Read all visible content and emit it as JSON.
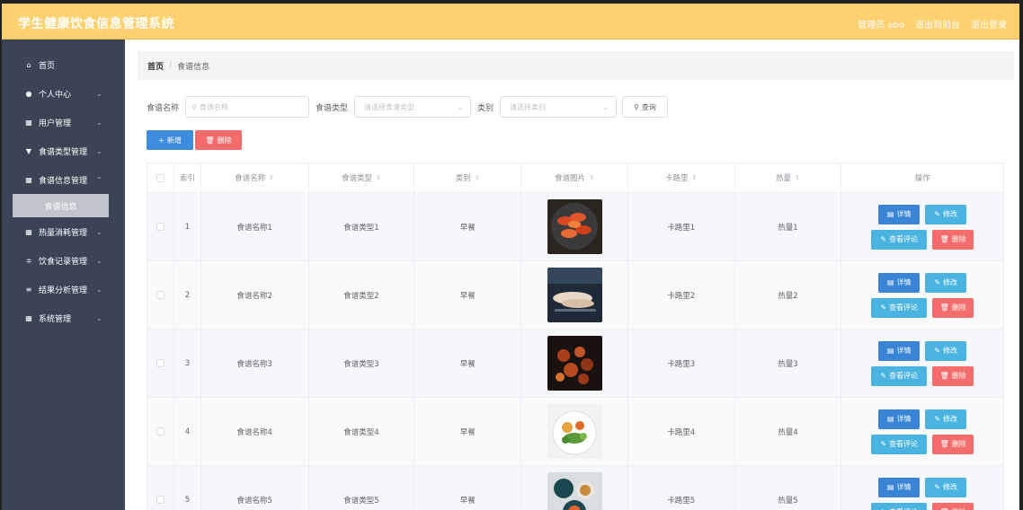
{
  "app_title": "学生健康饮食信息管理系统",
  "topbar": {
    "admin": "管理员 abo",
    "back_to_front": "退出到前台",
    "logout": "退出登录"
  },
  "sidebar": {
    "items": [
      {
        "label": "首页",
        "icon": "home-icon",
        "glyph": "⌂"
      },
      {
        "label": "个人中心",
        "icon": "user-icon",
        "glyph": "●"
      },
      {
        "label": "用户管理",
        "icon": "grid-icon",
        "glyph": "▦"
      },
      {
        "label": "食谱类型管理",
        "icon": "filter-icon",
        "glyph": "▼"
      },
      {
        "label": "食谱信息管理",
        "icon": "grid-icon",
        "glyph": "▦"
      },
      {
        "label": "热量消耗管理",
        "icon": "grid-icon",
        "glyph": "▦"
      },
      {
        "label": "饮食记录管理",
        "icon": "sliders-icon",
        "glyph": "≑"
      },
      {
        "label": "结果分析管理",
        "icon": "list-icon",
        "glyph": "≡"
      },
      {
        "label": "系统管理",
        "icon": "grid-icon",
        "glyph": "▦"
      }
    ],
    "submenu_label": "食谱信息"
  },
  "breadcrumb": {
    "home": "首页",
    "separator": "/",
    "current": "食谱信息"
  },
  "search": {
    "name_label": "食谱名称",
    "name_placeholder": "食谱名称",
    "type_label": "食谱类型",
    "type_placeholder": "请选择食谱类型",
    "category_label": "类别",
    "category_placeholder": "请选择类别",
    "query_label": "查询"
  },
  "actions": {
    "add_label": "新增",
    "delete_label": "删除"
  },
  "table": {
    "headers": [
      "索引",
      "食谱名称",
      "食谱类型",
      "类别",
      "食谱图片",
      "卡路里",
      "热量",
      "操作"
    ],
    "rows": [
      {
        "index": "1",
        "name": "食谱名称1",
        "type": "食谱类型1",
        "category": "早餐",
        "calories": "卡路里1",
        "heat": "热量1"
      },
      {
        "index": "2",
        "name": "食谱名称2",
        "type": "食谱类型2",
        "category": "早餐",
        "calories": "卡路里2",
        "heat": "热量2"
      },
      {
        "index": "3",
        "name": "食谱名称3",
        "type": "食谱类型3",
        "category": "早餐",
        "calories": "卡路里3",
        "heat": "热量3"
      },
      {
        "index": "4",
        "name": "食谱名称4",
        "type": "食谱类型4",
        "category": "早餐",
        "calories": "卡路里4",
        "heat": "热量4"
      },
      {
        "index": "5",
        "name": "食谱名称5",
        "type": "食谱类型5",
        "category": "早餐",
        "calories": "卡路里5",
        "heat": "热量5"
      }
    ],
    "ops": {
      "detail": "详情",
      "edit": "修改",
      "review": "查看评论",
      "delete": "删除"
    }
  },
  "colors": {
    "topbar": "#fdd170",
    "sidebar": "#3b4455",
    "primary": "#3a84d6",
    "danger": "#f56c6c",
    "info": "#4ab3e0"
  }
}
